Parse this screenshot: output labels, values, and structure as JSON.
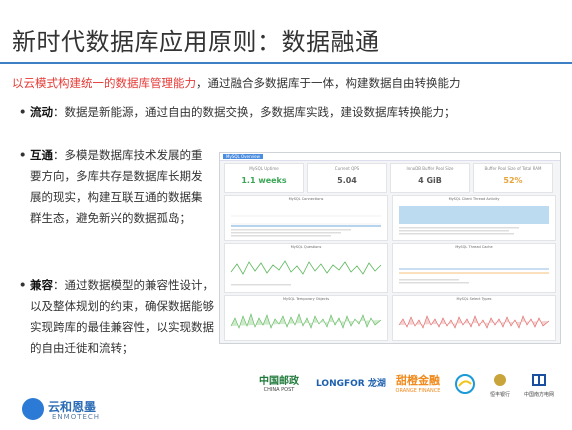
{
  "title": "新时代数据库应用原则：数据融通",
  "intro": {
    "highlight": "以云模式构建统一的数据库管理能力",
    "rest": "，通过融合多数据库于一体，构建数据自由转换能力"
  },
  "bullets": [
    {
      "head": "流动",
      "body": "：数据是新能源，通过自由的数据交换，多数据库实践，建设数据库转换能力；"
    },
    {
      "head": "互通",
      "body": "：多模是数据库技术发展的重要方向，多库共存是数据库长期发展的现实，构建互联互通的数据集群生态，避免新兴的数据孤岛；"
    },
    {
      "head": "兼容",
      "body": "：通过数据模型的兼容性设计，以及整体规划的约束，确保数据能够实现跨库的最佳兼容性，以实现数据的自由迁徙和流转；"
    }
  ],
  "bullet_mark": "•",
  "dashboard": {
    "tab": "MySQL Overview",
    "stats": [
      {
        "label": "MySQL Uptime",
        "value": "1.1 weeks",
        "color": "#3aa655"
      },
      {
        "label": "Current QPS",
        "value": "5.04",
        "color": "#333333"
      },
      {
        "label": "InnoDB Buffer Pool Size",
        "value": "4 GiB",
        "color": "#333333"
      },
      {
        "label": "Buffer Pool Size of Total RAM",
        "value": "52%",
        "color": "#e8a33c"
      }
    ],
    "panels": [
      "MySQL Connections",
      "MySQL Client Thread Activity",
      "MySQL Questions",
      "MySQL Thread Cache",
      "MySQL Temporary Objects",
      "MySQL Select Types"
    ]
  },
  "partners": [
    {
      "main": "中国邮政",
      "sub": "CHINA POST",
      "color": "#1f7a3a"
    },
    {
      "main": "LONGFOR 龙湖",
      "sub": "",
      "color": "#1b5fae"
    },
    {
      "main": "甜橙金融",
      "sub": "ORANGE FINANCE",
      "color": "#f08a1c"
    },
    {
      "main": "",
      "sub": "",
      "color": "#1a9ad6"
    },
    {
      "main": "",
      "sub": "恒丰银行",
      "color": "#c9a43a"
    },
    {
      "main": "",
      "sub": "中国南方电网",
      "color": "#1b4fa0"
    }
  ],
  "company": {
    "cn": "云和恩墨",
    "en": "ENMOTECH"
  }
}
